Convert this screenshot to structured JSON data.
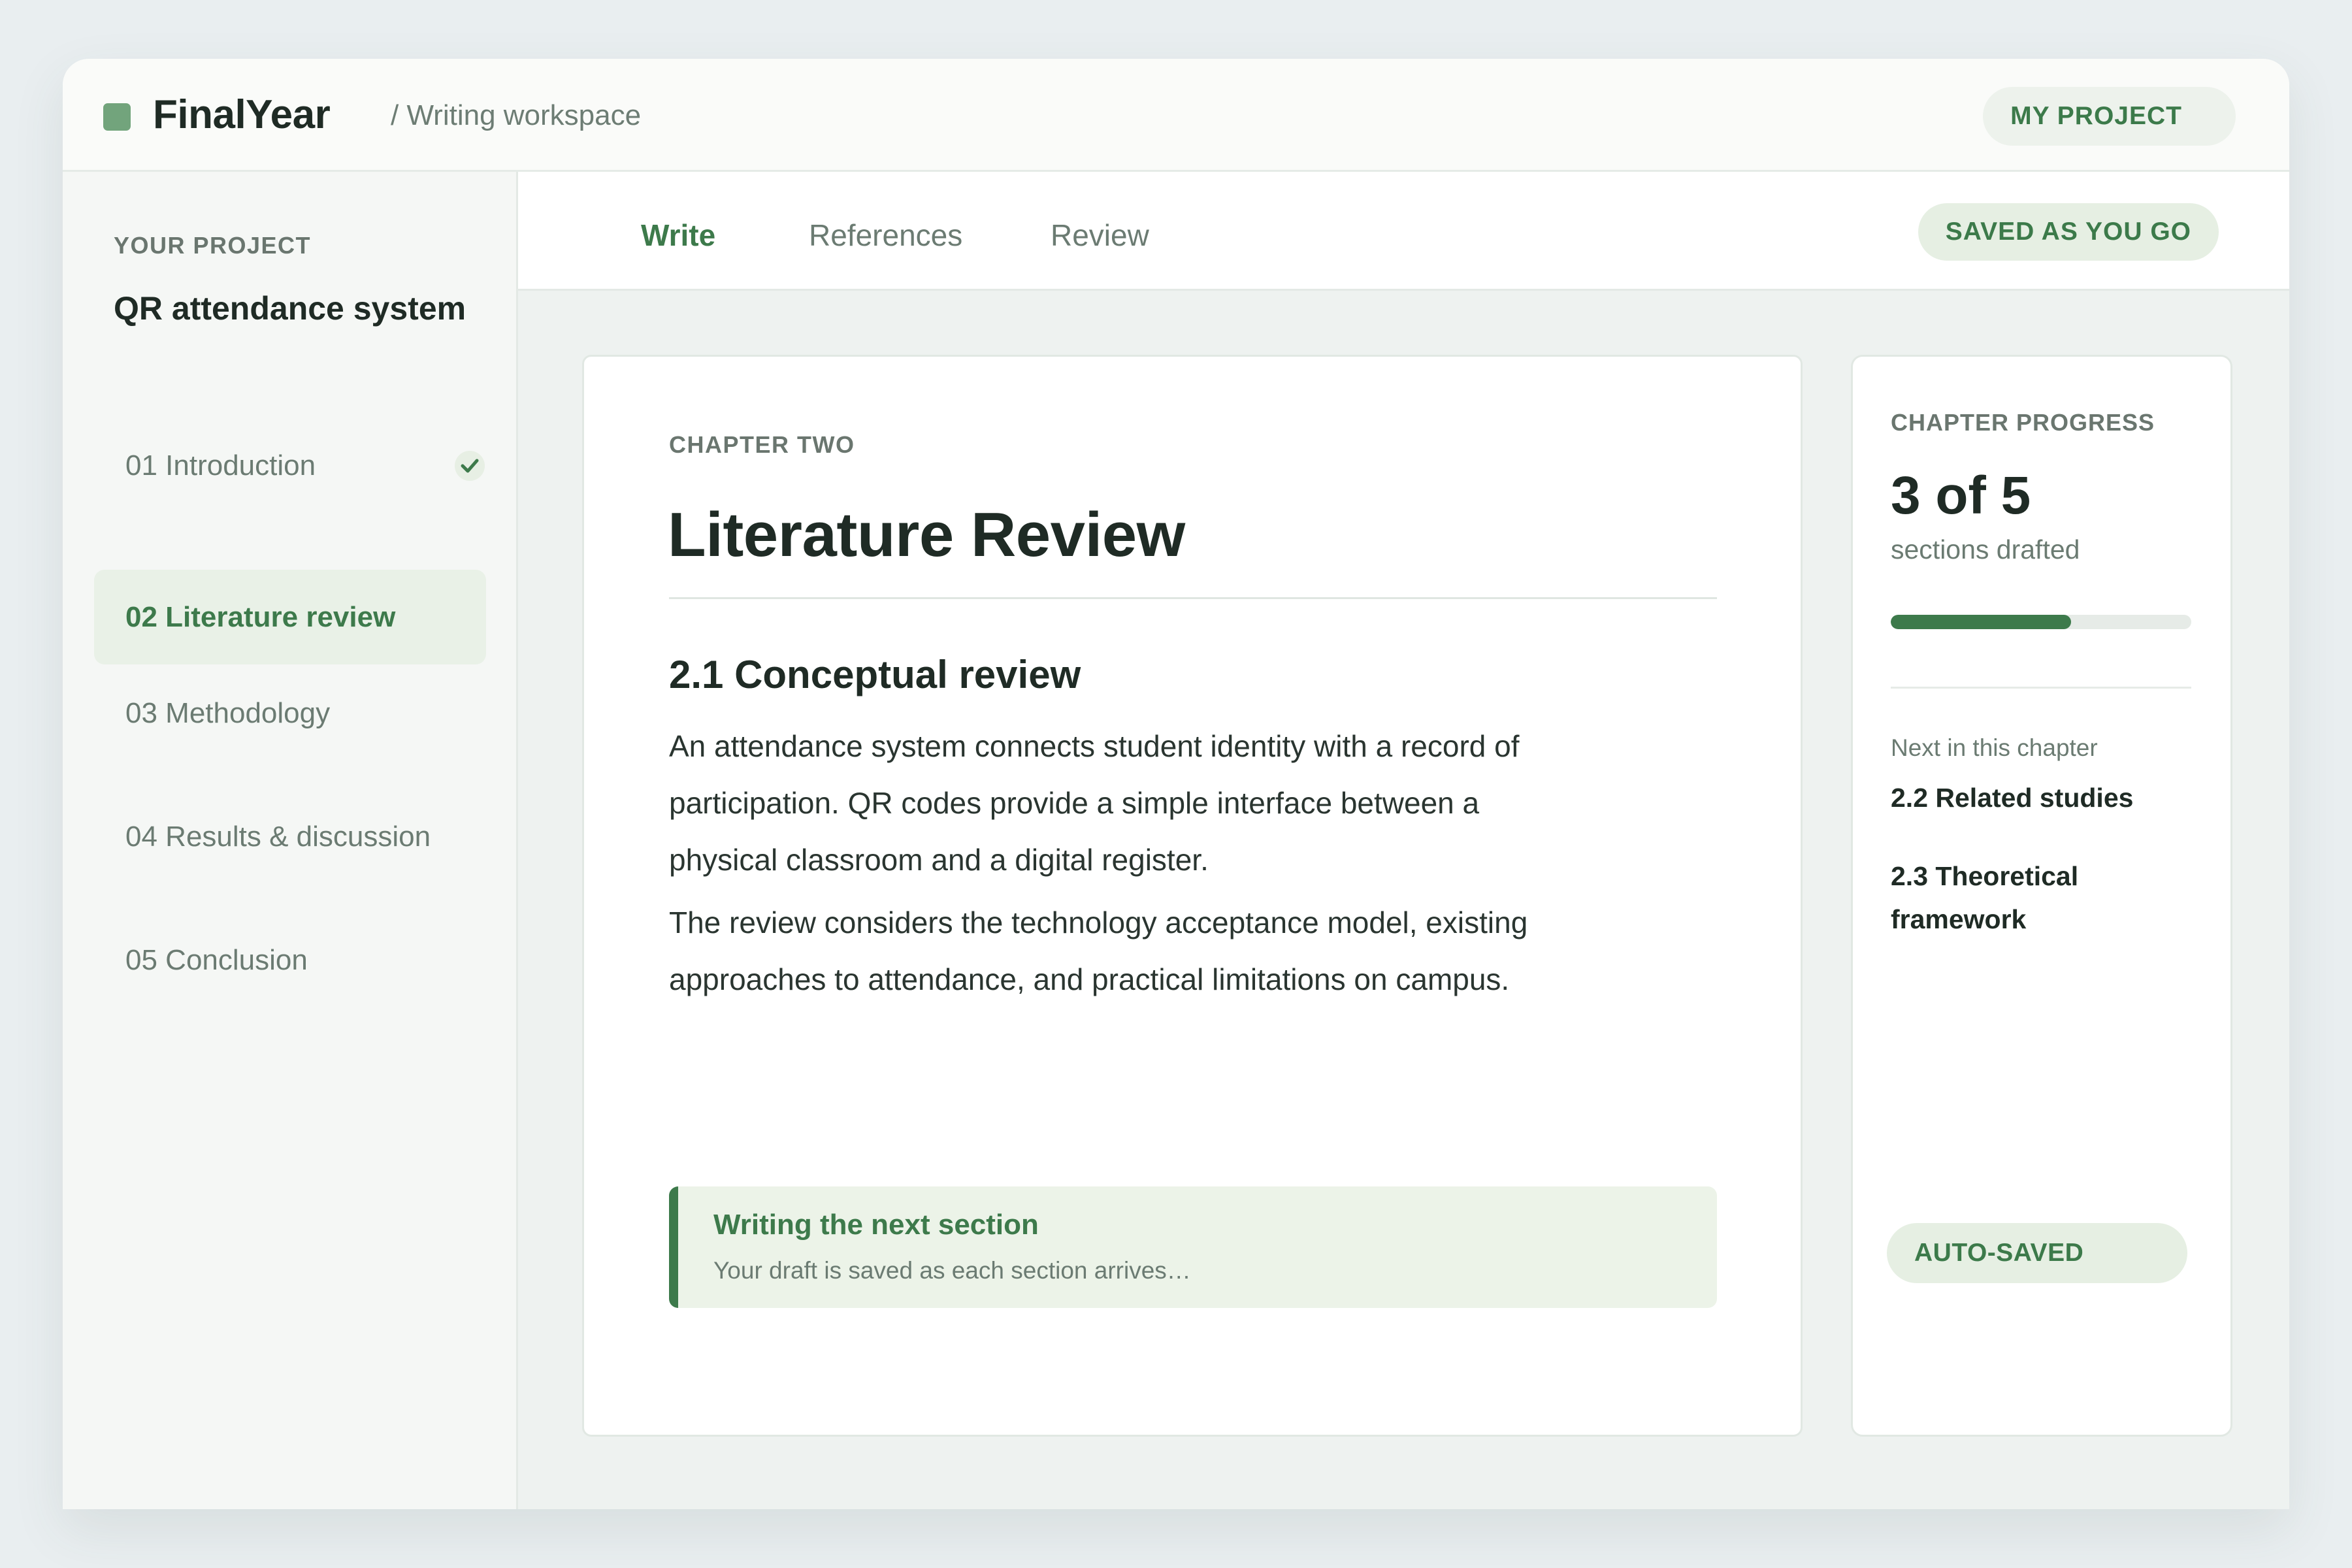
{
  "app": {
    "brand": "FinalYear",
    "breadcrumb": "/ Writing workspace",
    "project_button": "MY PROJECT"
  },
  "sidebar": {
    "label": "YOUR PROJECT",
    "project_title": "QR attendance system",
    "items": [
      {
        "label": "01 Introduction",
        "completed": true
      },
      {
        "label": "02 Literature review",
        "active": true
      },
      {
        "label": "03 Methodology"
      },
      {
        "label": "04 Results & discussion"
      },
      {
        "label": "05 Conclusion"
      }
    ]
  },
  "tabs": {
    "items": [
      {
        "label": "Write",
        "active": true
      },
      {
        "label": "References"
      },
      {
        "label": "Review"
      }
    ],
    "status_pill": "SAVED AS YOU GO"
  },
  "document": {
    "kicker": "CHAPTER TWO",
    "title": "Literature Review",
    "section_heading": "2.1 Conceptual review",
    "paragraphs": [
      "An attendance system connects student identity with a record of participation. QR codes provide a simple interface between a physical classroom and a digital register.",
      "The review considers the technology acceptance model, existing approaches to attendance, and practical limitations on campus."
    ],
    "callout": {
      "title": "Writing the next section",
      "subtitle": "Your draft is saved as each section arrives…"
    }
  },
  "progress": {
    "label": "CHAPTER PROGRESS",
    "headline": "3 of 5",
    "caption": "sections drafted",
    "fraction": 0.6,
    "next_label": "Next in this chapter",
    "next_items": [
      "2.2 Related studies",
      "2.3 Theoretical framework"
    ],
    "status_pill": "AUTO-SAVED"
  },
  "colors": {
    "accent": "#3d7a4b",
    "accent_light": "#e9f1e7",
    "logo": "#72a47c",
    "text_primary": "#1f2b25",
    "text_muted": "#6b7b72"
  },
  "icons": {
    "logo": "logo-square-icon",
    "completed": "check-icon"
  }
}
